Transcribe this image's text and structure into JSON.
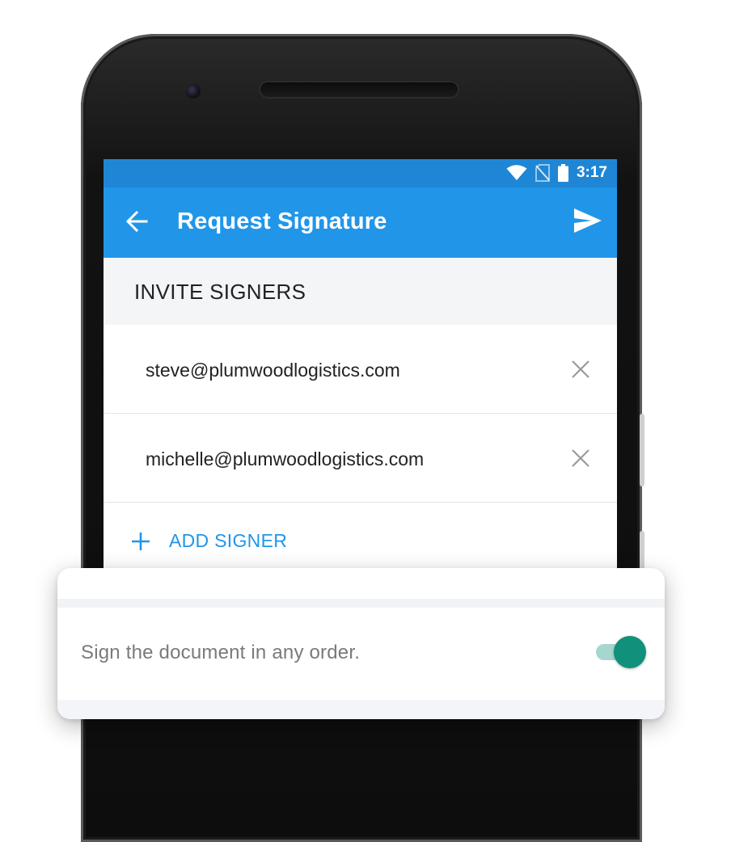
{
  "status_bar": {
    "time": "3:17",
    "icons": [
      "wifi-icon",
      "no-sim-icon",
      "battery-icon"
    ]
  },
  "app_bar": {
    "title": "Request Signature",
    "back_icon": "arrow-back-icon",
    "send_icon": "send-icon"
  },
  "section": {
    "title": "INVITE SIGNERS"
  },
  "signers": [
    {
      "email": "steve@plumwoodlogistics.com"
    },
    {
      "email": "michelle@plumwoodlogistics.com"
    }
  ],
  "add_signer": {
    "label": "ADD SIGNER"
  },
  "signing_order": {
    "label": "Sign the document in any order.",
    "enabled": true
  },
  "colors": {
    "status_bar": "#1f86d6",
    "app_bar": "#2196e9",
    "accent": "#2196e9",
    "toggle_on": "#11907c"
  }
}
